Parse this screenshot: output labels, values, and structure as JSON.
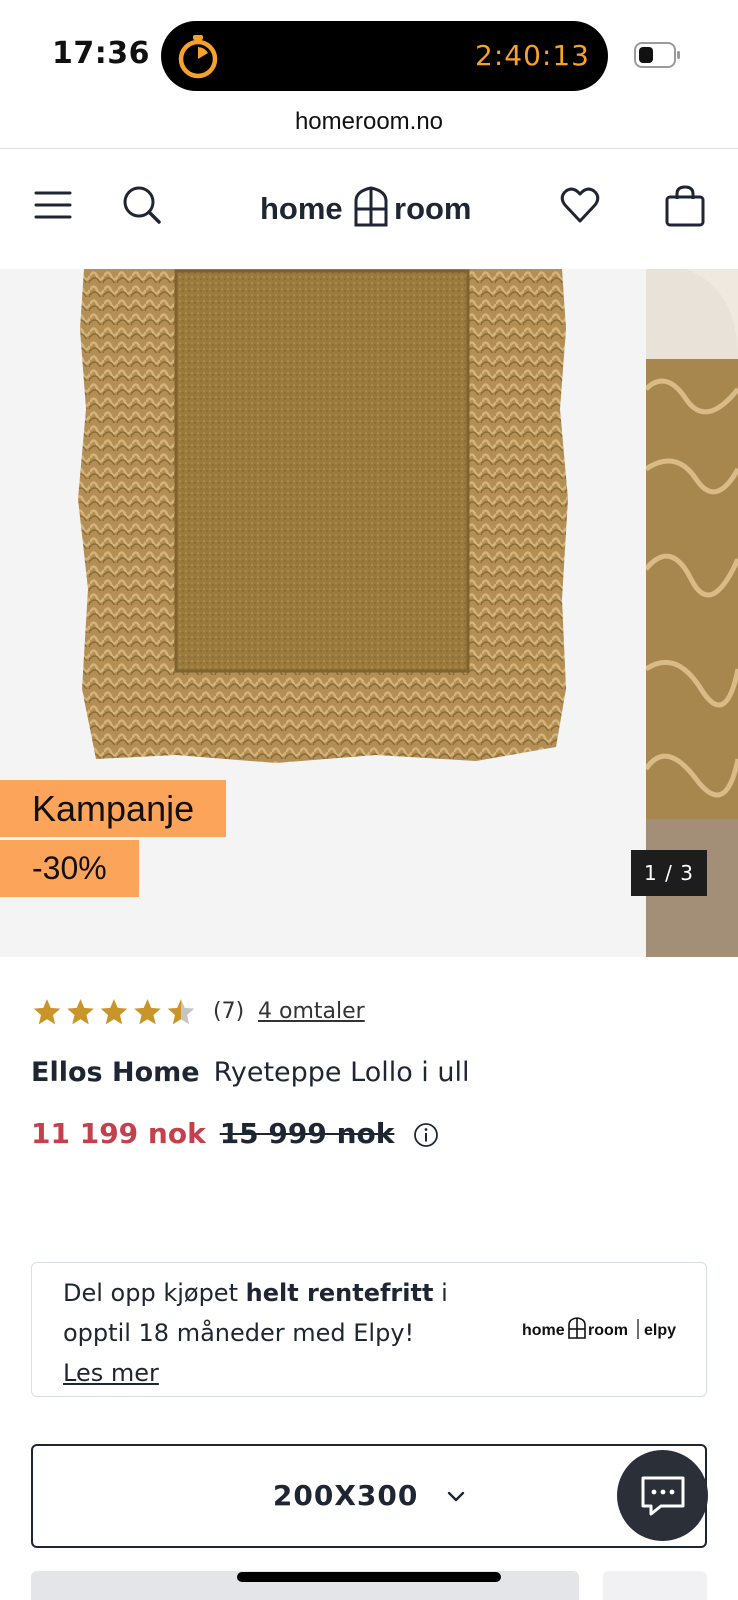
{
  "status_bar": {
    "time": "17:36",
    "timer": "2:40:13",
    "timer_icon": "stopwatch-icon",
    "battery_icon": "battery-icon"
  },
  "browser": {
    "url": "homeroom.no"
  },
  "nav": {
    "menu_icon": "hamburger-menu-icon",
    "search_icon": "search-icon",
    "logo_text_left": "home",
    "logo_text_right": "room",
    "wishlist_icon": "heart-icon",
    "cart_icon": "shopping-bag-icon"
  },
  "gallery": {
    "badge_campaign": "Kampanje",
    "badge_discount": "-30%",
    "pager": "1 / 3"
  },
  "product": {
    "rating": 4.5,
    "rating_max": 5,
    "review_count": "(7)",
    "review_link": "4 omtaler",
    "brand": "Ellos Home",
    "name": "Ryeteppe Lollo i ull",
    "price_sale": "11 199 nok",
    "price_original": "15 999 nok"
  },
  "elpy": {
    "text_before": "Del opp kjøpet ",
    "text_bold": "helt rentefritt",
    "text_after": " i opptil 18 måneder med Elpy!",
    "link": "Les mer",
    "logo_left": "home",
    "logo_mid": "room",
    "logo_right": "elpy"
  },
  "size_select": {
    "value": "200X300"
  },
  "colors": {
    "sale_red": "#c53f4d",
    "badge_orange": "#fca55a",
    "star_gold": "#c9952b",
    "timer_orange": "#f5a12a",
    "text_dark": "#1f2633"
  }
}
